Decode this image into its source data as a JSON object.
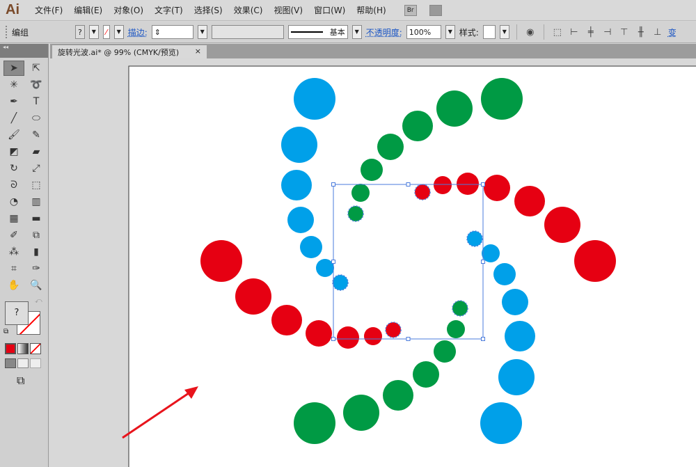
{
  "app": {
    "logo": "Ai"
  },
  "menu": [
    "文件(F)",
    "编辑(E)",
    "对象(O)",
    "文字(T)",
    "选择(S)",
    "效果(C)",
    "视图(V)",
    "窗口(W)",
    "帮助(H)"
  ],
  "bridge": "Br",
  "control": {
    "selection": "编组",
    "fill_value": "?",
    "stroke_label": "描边:",
    "brush": "基本",
    "opacity_label": "不透明度:",
    "opacity": "100%",
    "style_label": "样式:",
    "transform": "变"
  },
  "document_tab": {
    "title": "旋转光波.ai* @ 99% (CMYK/预览)",
    "close": "×"
  },
  "tools": {
    "fill_unknown": "?"
  },
  "colors": {
    "blue": "#00a0e9",
    "green": "#009a44",
    "red": "#e60012",
    "selection": "#4a7bdc",
    "arrow": "#e8141c"
  }
}
